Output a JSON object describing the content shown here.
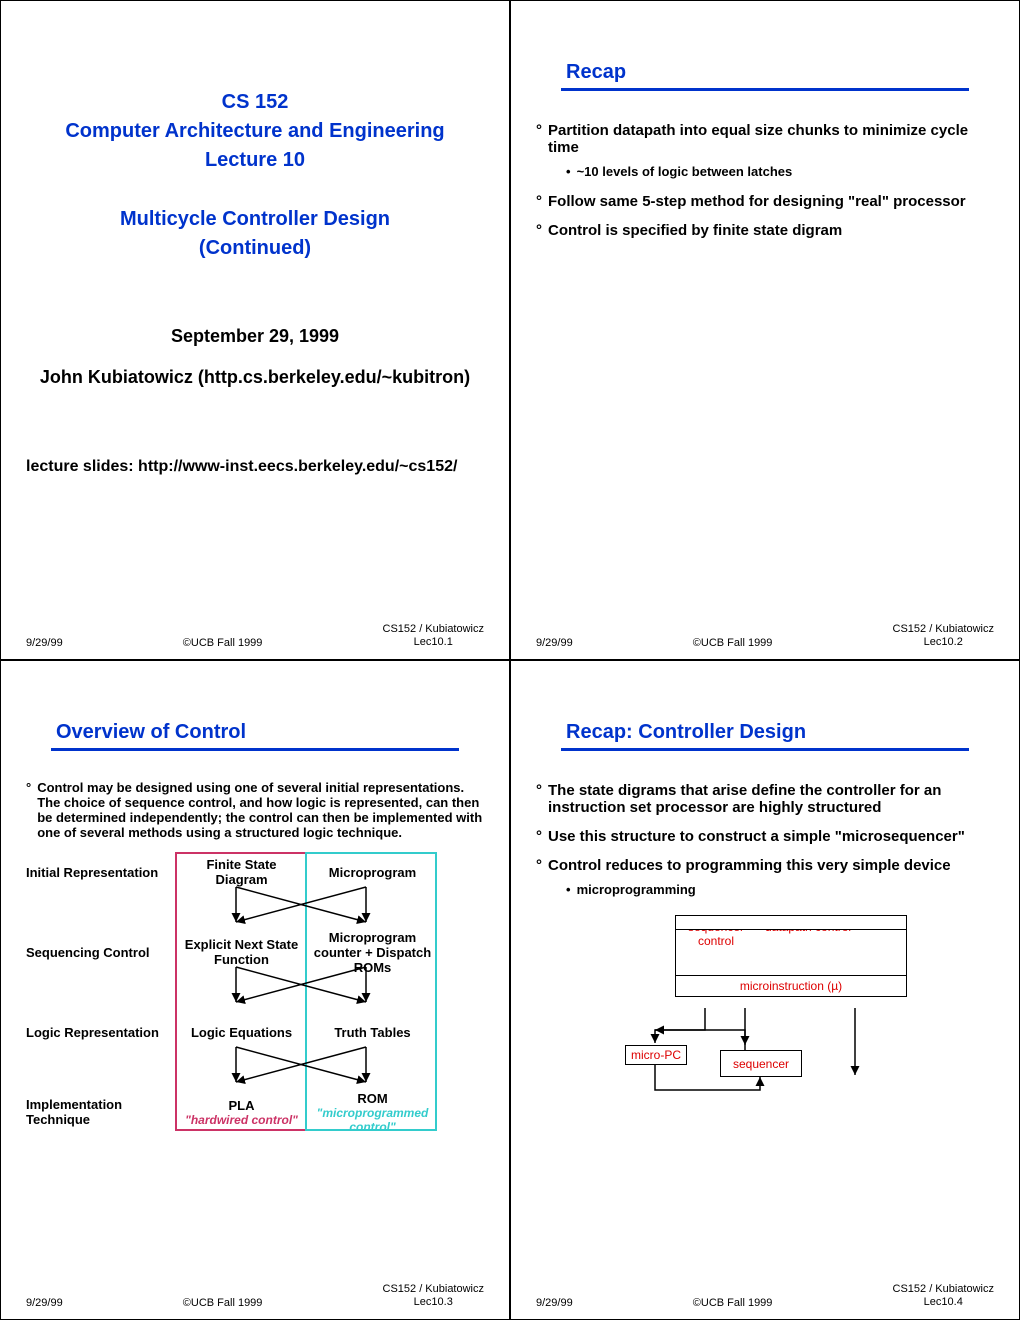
{
  "footer": {
    "date": "9/29/99",
    "center": "©UCB Fall 1999",
    "right_top": "CS152 / Kubiatowicz",
    "lec": {
      "s1": "Lec10.1",
      "s2": "Lec10.2",
      "s3": "Lec10.3",
      "s4": "Lec10.4"
    }
  },
  "slide1": {
    "t1": "CS 152",
    "t2": "Computer Architecture and Engineering",
    "t3": "Lecture 10",
    "t4": "Multicycle Controller Design",
    "t5": "(Continued)",
    "date": "September 29, 1999",
    "author": "John Kubiatowicz (http.cs.berkeley.edu/~kubitron)",
    "slides": "lecture slides: http://www-inst.eecs.berkeley.edu/~cs152/"
  },
  "slide2": {
    "title": "Recap",
    "b1": "Partition datapath into equal size chunks to minimize cycle time",
    "b1a": "~10 levels of logic between latches",
    "b2": "Follow same 5-step method for designing \"real\" processor",
    "b3": "Control is specified by finite state digram"
  },
  "slide3": {
    "title": "Overview of Control",
    "intro": "Control may be designed using one of several initial representations. The choice of sequence control, and how logic is represented, can then be determined independently; the control can then be implemented with one of several methods using a structured logic technique.",
    "rows": {
      "r1": {
        "label": "Initial Representation",
        "a": "Finite State Diagram",
        "b": "Microprogram"
      },
      "r2": {
        "label": "Sequencing Control",
        "a": "Explicit Next State Function",
        "b": "Microprogram counter + Dispatch ROMs"
      },
      "r3": {
        "label": "Logic Representation",
        "a": "Logic Equations",
        "b": "Truth Tables"
      },
      "r4": {
        "label": "Implementation Technique",
        "a": "PLA",
        "b": "ROM"
      }
    },
    "impl_a": "\"hardwired control\"",
    "impl_b": "\"microprogrammed control\""
  },
  "slide4": {
    "title": "Recap: Controller Design",
    "b1": "The state digrams that arise define the controller for an instruction set processor are highly structured",
    "b2": "Use this structure to construct a simple \"microsequencer\"",
    "b3": "Control reduces to programming this very simple device",
    "b3a": "microprogramming",
    "diag": {
      "seq_ctrl": "sequencer control",
      "dp_ctrl": "datapath control",
      "microinst": "microinstruction (µ)",
      "micro_pc": "micro-PC",
      "sequencer": "sequencer"
    }
  }
}
